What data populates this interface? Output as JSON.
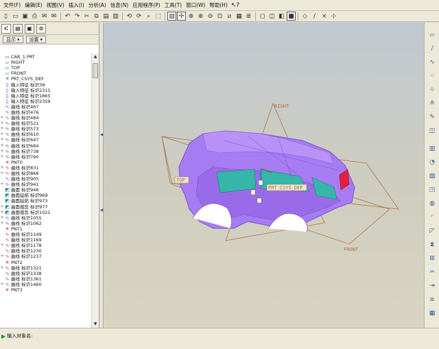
{
  "menu": [
    "文件(F)",
    "编辑(E)",
    "视图(V)",
    "插入(I)",
    "分析(A)",
    "信息(N)",
    "应用程序(P)",
    "工具(T)",
    "窗口(W)",
    "帮助(H)"
  ],
  "toolbar_icons": [
    "new-icon",
    "open-icon",
    "save-icon",
    "print-icon",
    "email-icon",
    "email-attach-icon",
    "undo-icon",
    "redo-icon",
    "cut-icon",
    "copy-icon",
    "paste-icon",
    "paste-special-icon",
    "regenerate-icon",
    "regen-manager-icon",
    "find-icon",
    "select-box-icon",
    "repaint-icon",
    "spin-center-icon",
    "orient-mode-icon",
    "zoom-in-icon",
    "zoom-out-icon",
    "refit-icon",
    "reorient-icon",
    "saved-views-icon",
    "layers-icon",
    "wireframe-icon",
    "hidden-line-icon",
    "no-hidden-icon",
    "shading-icon",
    "datum-planes-icon",
    "datum-axes-icon",
    "datum-points-icon",
    "csys-icon",
    "whats-this-icon"
  ],
  "left": {
    "controls": {
      "show": "显示",
      "settings": "设置"
    },
    "tree": [
      {
        "exp": "",
        "icon": "part",
        "label": "CAR_1.PRT"
      },
      {
        "exp": "",
        "icon": "plane",
        "label": "RIGHT"
      },
      {
        "exp": "",
        "icon": "plane",
        "label": "TOP"
      },
      {
        "exp": "",
        "icon": "plane",
        "label": "FRONT"
      },
      {
        "exp": "",
        "icon": "csys",
        "label": "PRT_CSYS_DEF"
      },
      {
        "exp": "",
        "icon": "import",
        "label": "输入特征 标识39"
      },
      {
        "exp": "",
        "icon": "import",
        "label": "输入特征 标识2311"
      },
      {
        "exp": "",
        "icon": "import",
        "label": "输入特征 标识1865"
      },
      {
        "exp": "",
        "icon": "import",
        "label": "输入特征 标识2359"
      },
      {
        "exp": "",
        "icon": "curve",
        "label": "曲线 标识467"
      },
      {
        "exp": "",
        "icon": "curve",
        "label": "曲线 标识476"
      },
      {
        "exp": "+",
        "icon": "curve",
        "label": "曲线 标识484"
      },
      {
        "exp": "+",
        "icon": "curve",
        "label": "曲线 标识521"
      },
      {
        "exp": "+",
        "icon": "curve",
        "label": "曲线 标识573"
      },
      {
        "exp": "+",
        "icon": "curve",
        "label": "曲线 标识610"
      },
      {
        "exp": "+",
        "icon": "curve",
        "label": "曲线 标识647"
      },
      {
        "exp": "+",
        "icon": "curve",
        "label": "曲线 标识684"
      },
      {
        "exp": "+",
        "icon": "curve",
        "label": "曲线 标识738"
      },
      {
        "exp": "+",
        "icon": "curve",
        "label": "曲线 标识790"
      },
      {
        "exp": "",
        "icon": "point",
        "label": "PNT0"
      },
      {
        "exp": "+",
        "icon": "curve",
        "label": "曲线 标识831"
      },
      {
        "exp": "+",
        "icon": "curve",
        "label": "曲线 标识868"
      },
      {
        "exp": "",
        "icon": "curve",
        "label": "曲线 标识905"
      },
      {
        "exp": "+",
        "icon": "curve",
        "label": "曲线 标识941"
      },
      {
        "exp": "",
        "icon": "surf",
        "label": "曲面 标识946"
      },
      {
        "exp": "",
        "icon": "surf",
        "label": "曲面延拓 标识969"
      },
      {
        "exp": "",
        "icon": "surf",
        "label": "曲面延拓 标识973"
      },
      {
        "exp": "+",
        "icon": "surf",
        "label": "曲面裁剪 标识977"
      },
      {
        "exp": "+",
        "icon": "surf",
        "label": "曲面裁剪 标识1021"
      },
      {
        "exp": "+",
        "icon": "curve",
        "label": "曲线 标识1055"
      },
      {
        "exp": "+",
        "icon": "curve",
        "label": "曲线 标识1062"
      },
      {
        "exp": "",
        "icon": "point",
        "label": "PNT1"
      },
      {
        "exp": "",
        "icon": "curve",
        "label": "曲线 标识1149"
      },
      {
        "exp": "",
        "icon": "curve",
        "label": "曲线 标识1169"
      },
      {
        "exp": "+",
        "icon": "curve",
        "label": "曲线 标识1178"
      },
      {
        "exp": "",
        "icon": "curve",
        "label": "曲线 标识1230"
      },
      {
        "exp": "+",
        "icon": "curve",
        "label": "曲线 标识1237"
      },
      {
        "exp": "",
        "icon": "point",
        "label": "PNT2"
      },
      {
        "exp": "+",
        "icon": "curve",
        "label": "曲线 标识1321"
      },
      {
        "exp": "",
        "icon": "curve",
        "label": "曲线 标识1338"
      },
      {
        "exp": "",
        "icon": "curve",
        "label": "曲线 标识1361"
      },
      {
        "exp": "+",
        "icon": "curve",
        "label": "曲线 标识1460"
      },
      {
        "exp": "",
        "icon": "point",
        "label": "PNT3"
      }
    ]
  },
  "viewport": {
    "datum_labels": {
      "right": "RIGHT",
      "top": "TOP",
      "front": "FRONT",
      "csys": "PRT_CSYS_DEF"
    },
    "colors": {
      "body": "#a77cf2",
      "body_dark": "#7e4fd0",
      "datum": "#b07040",
      "window": "#35b6a8",
      "taillight": "#e02040"
    }
  },
  "status": {
    "prompt": "输入对象名:"
  }
}
